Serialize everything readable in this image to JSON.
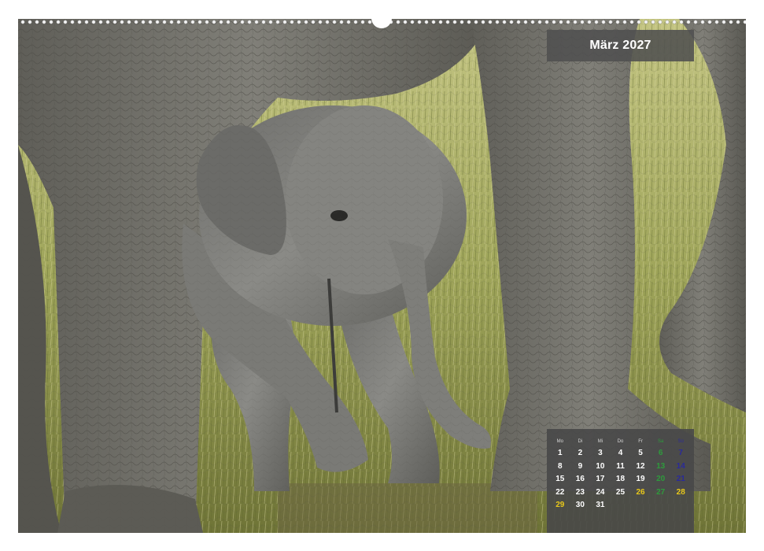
{
  "calendar_header": {
    "month_title": "März 2027"
  },
  "calendar": {
    "weekdays": [
      "Mo",
      "Di",
      "Mi",
      "Do",
      "Fr",
      "Sa",
      "So"
    ],
    "weeks": [
      [
        "1",
        "2",
        "3",
        "4",
        "5",
        "6",
        "7"
      ],
      [
        "8",
        "9",
        "10",
        "11",
        "12",
        "13",
        "14"
      ],
      [
        "15",
        "16",
        "17",
        "18",
        "19",
        "20",
        "21"
      ],
      [
        "22",
        "23",
        "24",
        "25",
        "26",
        "27",
        "28"
      ],
      [
        "29",
        "30",
        "31",
        "",
        "",
        "",
        ""
      ]
    ],
    "holidays": [
      "26",
      "28",
      "29"
    ],
    "colors": {
      "weekday": "#ffffff",
      "saturday": "#2e9a3c",
      "sunday": "#2a2a9a",
      "holiday": "#e8c81a",
      "panel": "#484848"
    }
  },
  "photo": {
    "subject": "elephant-calf-between-adult-legs",
    "colors": {
      "grass": "#a6ab62",
      "elephant_skin": "#6f6e68",
      "calf_skin": "#7b7b78"
    }
  }
}
